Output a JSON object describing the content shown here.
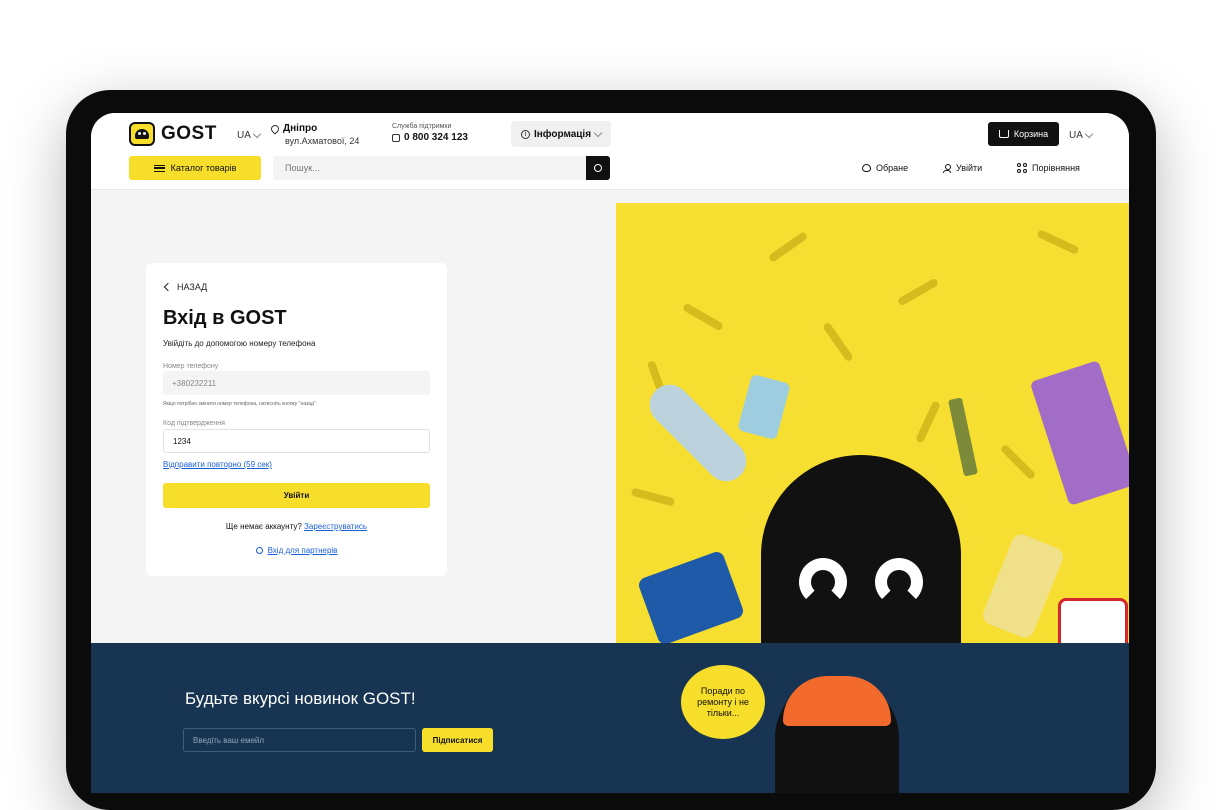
{
  "header": {
    "logo_text": "GOST",
    "lang_left": "UA",
    "city": "Дніпро",
    "address": "вул.Ахматової, 24",
    "support_label": "Служба підтримки",
    "support_phone": "0 800 324 123",
    "info_label": "Інформація",
    "cart_label": "Корзина",
    "lang_right": "UA",
    "catalog_label": "Каталог товарів",
    "search_placeholder": "Пошук...",
    "favorites_label": "Обране",
    "login_label": "Увійти",
    "compare_label": "Порівняння"
  },
  "login": {
    "back_label": "НАЗАД",
    "title": "Вхід в GOST",
    "subtitle": "Увійдіть до допомогою номеру телефона",
    "phone_label": "Номер телефону",
    "phone_value": "+380232211",
    "phone_hint": "Якщо потрібно змінити номер телефона, натисніть кнопку \"назад\"",
    "code_label": "Код підтвердження",
    "code_value": "1234",
    "resend_label": "Відправити повторно (59 сек)",
    "submit_label": "Увійти",
    "no_account_text": "Ще немає аккаунту?",
    "register_label": "Зареєструватись",
    "partners_label": "Вхід для партнерів"
  },
  "newsletter": {
    "title": "Будьте вкурсі новинок GOST!",
    "email_placeholder": "Введіть ваш емейл",
    "subscribe_label": "Підписатися",
    "bubble_text": "Поради по ремонту і не тільки..."
  },
  "colors": {
    "accent": "#f7de2a",
    "dark": "#111111",
    "link": "#1a5fd6",
    "footer_bg": "#173552"
  },
  "icons": [
    "gost-logo-icon",
    "chevron-down-icon",
    "map-pin-icon",
    "phone-icon",
    "info-icon",
    "basket-icon",
    "menu-icon",
    "search-icon",
    "heart-icon",
    "user-icon",
    "compare-icon",
    "chevron-left-icon",
    "key-icon"
  ]
}
